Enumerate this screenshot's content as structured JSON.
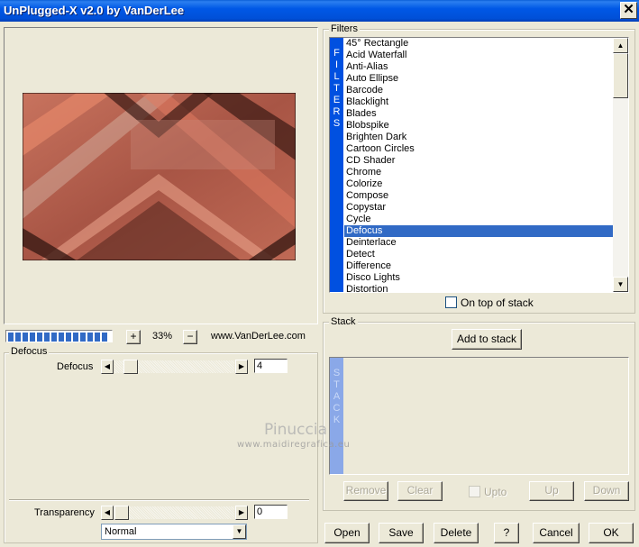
{
  "window": {
    "title": "UnPlugged-X v2.0 by VanDerLee",
    "close_glyph": "✕"
  },
  "preview": {
    "zoom": "33%",
    "zoom_in": "+",
    "zoom_out": "−",
    "website": "www.VanDerLee.com",
    "progress": 1.0,
    "colors": {
      "dark": "#3a1a14",
      "mid": "#a04a3a",
      "light": "#e07a60",
      "pale": "#d8b8a8"
    }
  },
  "params": {
    "group_label": "Defocus",
    "defocus_label": "Defocus",
    "defocus_value": "4",
    "transparency_label": "Transparency",
    "transparency_value": "0",
    "blend_mode": "Normal"
  },
  "filters": {
    "group_label": "Filters",
    "side_label": "FILTERS",
    "items": [
      "45° Rectangle",
      "Acid Waterfall",
      "Anti-Alias",
      "Auto Ellipse",
      "Barcode",
      "Blacklight",
      "Blades",
      "Blobspike",
      "Brighten Dark",
      "Cartoon Circles",
      "CD Shader",
      "Chrome",
      "Colorize",
      "Compose",
      "Copystar",
      "Cycle",
      "Defocus",
      "Deinterlace",
      "Detect",
      "Difference",
      "Disco Lights",
      "Distortion"
    ],
    "selected": "Defocus",
    "on_top_label": "On top of stack"
  },
  "stack": {
    "group_label": "Stack",
    "side_label": "STACK",
    "add_label": "Add to stack",
    "remove_label": "Remove",
    "clear_label": "Clear",
    "upto_label": "Upto",
    "up_label": "Up",
    "down_label": "Down"
  },
  "buttons": {
    "open": "Open",
    "save": "Save",
    "delete": "Delete",
    "help": "?",
    "cancel": "Cancel",
    "ok": "OK"
  },
  "watermark": {
    "line1": "Pinuccia",
    "line2": "www.maidiregrafica.eu"
  }
}
